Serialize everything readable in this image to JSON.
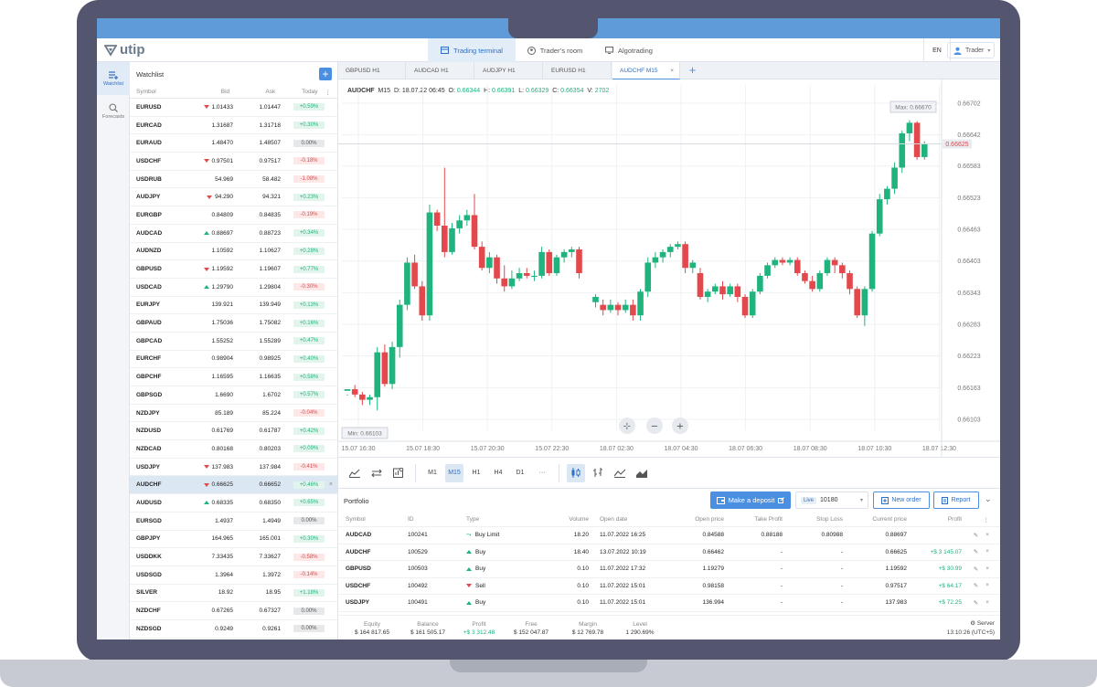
{
  "brand": {
    "name": "utip"
  },
  "nav": {
    "tabs": [
      {
        "label": "Trading terminal",
        "active": true
      },
      {
        "label": "Trader’s room",
        "active": false
      },
      {
        "label": "Algotrading",
        "active": false
      }
    ],
    "lang": "EN",
    "user": "Trader"
  },
  "sidebar": {
    "items": [
      {
        "label": "Watchlist",
        "icon": "watchlist-icon",
        "active": true
      },
      {
        "label": "Forecasts",
        "icon": "forecasts-icon",
        "active": false
      }
    ]
  },
  "watchlist": {
    "title": "Watchlist",
    "columns": [
      "Symbol",
      "Bid",
      "Ask",
      "Today"
    ],
    "rows": [
      {
        "symbol": "EURUSD",
        "bid": "1.01433",
        "ask": "1.01447",
        "today": "+0.59%",
        "dir": "down",
        "trend": "pos"
      },
      {
        "symbol": "EURCAD",
        "bid": "1.31687",
        "ask": "1.31718",
        "today": "+0.30%",
        "dir": "",
        "trend": "pos"
      },
      {
        "symbol": "EURAUD",
        "bid": "1.48470",
        "ask": "1.48507",
        "today": "0.00%",
        "dir": "",
        "trend": "zero"
      },
      {
        "symbol": "USDCHF",
        "bid": "0.97501",
        "ask": "0.97517",
        "today": "-0.18%",
        "dir": "down",
        "trend": "neg"
      },
      {
        "symbol": "USDRUB",
        "bid": "54.969",
        "ask": "58.482",
        "today": "-1.08%",
        "dir": "",
        "trend": "neg"
      },
      {
        "symbol": "AUDJPY",
        "bid": "94.290",
        "ask": "94.321",
        "today": "+0.23%",
        "dir": "down",
        "trend": "pos"
      },
      {
        "symbol": "EURGBP",
        "bid": "0.84809",
        "ask": "0.84835",
        "today": "-0.19%",
        "dir": "",
        "trend": "neg"
      },
      {
        "symbol": "AUDCAD",
        "bid": "0.88697",
        "ask": "0.88723",
        "today": "+0.34%",
        "dir": "up",
        "trend": "pos"
      },
      {
        "symbol": "AUDNZD",
        "bid": "1.10592",
        "ask": "1.10627",
        "today": "+0.28%",
        "dir": "",
        "trend": "pos"
      },
      {
        "symbol": "GBPUSD",
        "bid": "1.19592",
        "ask": "1.19607",
        "today": "+0.77%",
        "dir": "down",
        "trend": "pos"
      },
      {
        "symbol": "USDCAD",
        "bid": "1.29790",
        "ask": "1.29804",
        "today": "-0.30%",
        "dir": "up",
        "trend": "neg"
      },
      {
        "symbol": "EURJPY",
        "bid": "139.921",
        "ask": "139.949",
        "today": "+0.13%",
        "dir": "",
        "trend": "pos"
      },
      {
        "symbol": "GBPAUD",
        "bid": "1.75036",
        "ask": "1.75082",
        "today": "+0.16%",
        "dir": "",
        "trend": "pos"
      },
      {
        "symbol": "GBPCAD",
        "bid": "1.55252",
        "ask": "1.55289",
        "today": "+0.47%",
        "dir": "",
        "trend": "pos"
      },
      {
        "symbol": "EURCHF",
        "bid": "0.98904",
        "ask": "0.98925",
        "today": "+0.40%",
        "dir": "",
        "trend": "pos"
      },
      {
        "symbol": "GBPCHF",
        "bid": "1.16595",
        "ask": "1.16635",
        "today": "+0.58%",
        "dir": "",
        "trend": "pos"
      },
      {
        "symbol": "GBPSGD",
        "bid": "1.6690",
        "ask": "1.6702",
        "today": "+0.57%",
        "dir": "",
        "trend": "pos"
      },
      {
        "symbol": "NZDJPY",
        "bid": "85.189",
        "ask": "85.224",
        "today": "-0.04%",
        "dir": "",
        "trend": "neg"
      },
      {
        "symbol": "NZDUSD",
        "bid": "0.61769",
        "ask": "0.61787",
        "today": "+0.42%",
        "dir": "",
        "trend": "pos"
      },
      {
        "symbol": "NZDCAD",
        "bid": "0.80168",
        "ask": "0.80203",
        "today": "+0.09%",
        "dir": "",
        "trend": "pos"
      },
      {
        "symbol": "USDJPY",
        "bid": "137.983",
        "ask": "137.984",
        "today": "-0.41%",
        "dir": "down",
        "trend": "neg"
      },
      {
        "symbol": "AUDCHF",
        "bid": "0.66625",
        "ask": "0.66652",
        "today": "+0.46%",
        "dir": "down",
        "trend": "pos",
        "selected": true
      },
      {
        "symbol": "AUDUSD",
        "bid": "0.68335",
        "ask": "0.68350",
        "today": "+0.65%",
        "dir": "up",
        "trend": "pos"
      },
      {
        "symbol": "EURSGD",
        "bid": "1.4937",
        "ask": "1.4949",
        "today": "0.00%",
        "dir": "",
        "trend": "zero"
      },
      {
        "symbol": "GBPJPY",
        "bid": "164.965",
        "ask": "165.001",
        "today": "+0.30%",
        "dir": "",
        "trend": "pos"
      },
      {
        "symbol": "USDDKK",
        "bid": "7.33435",
        "ask": "7.33627",
        "today": "-0.58%",
        "dir": "",
        "trend": "neg"
      },
      {
        "symbol": "USDSGD",
        "bid": "1.3964",
        "ask": "1.3972",
        "today": "-0.14%",
        "dir": "",
        "trend": "neg"
      },
      {
        "symbol": "SILVER",
        "bid": "18.92",
        "ask": "18.95",
        "today": "+1.18%",
        "dir": "",
        "trend": "pos"
      },
      {
        "symbol": "NZDCHF",
        "bid": "0.67265",
        "ask": "0.67327",
        "today": "0.00%",
        "dir": "",
        "trend": "zero"
      },
      {
        "symbol": "NZDSGD",
        "bid": "0.9249",
        "ask": "0.9261",
        "today": "0.00%",
        "dir": "",
        "trend": "zero"
      }
    ]
  },
  "chart_tabs": [
    {
      "label": "GBPUSD H1",
      "active": false
    },
    {
      "label": "AUDCAD H1",
      "active": false
    },
    {
      "label": "AUDJPY H1",
      "active": false
    },
    {
      "label": "EURUSD H1",
      "active": false
    },
    {
      "label": "AUDCHF M15",
      "active": true
    }
  ],
  "ohlc": {
    "symbol": "AUDCHF",
    "tf": "M15",
    "d": "D: 18.07.22 06:45",
    "o_label": "O:",
    "o": "0.66344",
    "h_label": "H:",
    "h": "0.66391",
    "l_label": "L:",
    "l": "0.66329",
    "c_label": "C:",
    "c": "0.66354",
    "v_label": "V:",
    "v": "2702"
  },
  "chart_data": {
    "type": "candlestick",
    "y_ticks": [
      "0.66702",
      "0.66642",
      "0.66583",
      "0.66523",
      "0.66463",
      "0.66403",
      "0.66343",
      "0.66283",
      "0.66223",
      "0.66163",
      "0.66103"
    ],
    "ylim": [
      0.66103,
      0.66702
    ],
    "x_ticks": [
      "15.07 16:30",
      "15.07 18:30",
      "15.07 20:30",
      "15.07 22:30",
      "18.07 02:30",
      "18.07 04:30",
      "18.07 06:30",
      "18.07 08:30",
      "18.07 10:30",
      "18.07 12:30"
    ],
    "current_price": "0.66625",
    "max_label": "Max: 0.66670",
    "min_label": "Min: 0.66103",
    "candles": [
      [
        0.66157,
        0.6616,
        0.6615,
        0.66148
      ],
      [
        0.6616,
        0.6615,
        0.66145,
        0.66168
      ],
      [
        0.6615,
        0.6614,
        0.6613,
        0.66155
      ],
      [
        0.6614,
        0.66145,
        0.6613,
        0.6615
      ],
      [
        0.66145,
        0.6623,
        0.6612,
        0.6624
      ],
      [
        0.6623,
        0.6617,
        0.66165,
        0.66245
      ],
      [
        0.6617,
        0.6624,
        0.6616,
        0.6625
      ],
      [
        0.6624,
        0.6632,
        0.6622,
        0.6633
      ],
      [
        0.6632,
        0.664,
        0.6631,
        0.6641
      ],
      [
        0.664,
        0.66355,
        0.6635,
        0.66415
      ],
      [
        0.66355,
        0.663,
        0.6629,
        0.66365
      ],
      [
        0.663,
        0.66495,
        0.6629,
        0.6651
      ],
      [
        0.66495,
        0.6647,
        0.6646,
        0.665
      ],
      [
        0.6647,
        0.6642,
        0.6641,
        0.6658
      ],
      [
        0.6642,
        0.66465,
        0.66415,
        0.66475
      ],
      [
        0.66465,
        0.6648,
        0.66455,
        0.6649
      ],
      [
        0.6648,
        0.6649,
        0.6647,
        0.665
      ],
      [
        0.6649,
        0.6643,
        0.66425,
        0.6653
      ],
      [
        0.6643,
        0.6639,
        0.66385,
        0.6644
      ],
      [
        0.6639,
        0.6641,
        0.6638,
        0.6642
      ],
      [
        0.6641,
        0.6637,
        0.6636,
        0.66415
      ],
      [
        0.6637,
        0.66355,
        0.66345,
        0.66395
      ],
      [
        0.66355,
        0.6637,
        0.6635,
        0.66385
      ],
      [
        0.6637,
        0.6638,
        0.66365,
        0.6639
      ],
      [
        0.6638,
        0.66375,
        0.6637,
        0.6639
      ],
      [
        0.66375,
        0.66375,
        0.66365,
        0.66385
      ],
      [
        0.66375,
        0.6642,
        0.6637,
        0.6643
      ],
      [
        0.6642,
        0.6638,
        0.66375,
        0.66425
      ],
      [
        0.6638,
        0.6641,
        0.66375,
        0.66415
      ],
      [
        0.6641,
        0.6642,
        0.664,
        0.66425
      ],
      [
        0.6642,
        0.66425,
        0.6641,
        0.6643
      ],
      [
        0.66425,
        0.6638,
        0.6637,
        0.6643
      ],
      [
        0.66325,
        0.66335,
        0.66315,
        0.6634
      ],
      [
        0.6632,
        0.6631,
        0.663,
        0.6633
      ],
      [
        0.6631,
        0.6632,
        0.66305,
        0.6633
      ],
      [
        0.6632,
        0.6631,
        0.663,
        0.66325
      ],
      [
        0.6631,
        0.6632,
        0.66305,
        0.6633
      ],
      [
        0.6632,
        0.663,
        0.6629,
        0.6633
      ],
      [
        0.663,
        0.66345,
        0.6629,
        0.6635
      ],
      [
        0.66345,
        0.664,
        0.66335,
        0.6641
      ],
      [
        0.664,
        0.6641,
        0.6639,
        0.6642
      ],
      [
        0.6641,
        0.6642,
        0.664,
        0.66425
      ],
      [
        0.6642,
        0.6643,
        0.6641,
        0.66435
      ],
      [
        0.6643,
        0.66435,
        0.66425,
        0.6644
      ],
      [
        0.66435,
        0.6639,
        0.6638,
        0.6644
      ],
      [
        0.6639,
        0.664,
        0.6638,
        0.66405
      ],
      [
        0.6638,
        0.66335,
        0.6633,
        0.6639
      ],
      [
        0.66335,
        0.66345,
        0.66325,
        0.6635
      ],
      [
        0.66345,
        0.66355,
        0.6634,
        0.6636
      ],
      [
        0.66355,
        0.6634,
        0.6633,
        0.66365
      ],
      [
        0.6634,
        0.66355,
        0.66335,
        0.6636
      ],
      [
        0.66355,
        0.66335,
        0.66325,
        0.6636
      ],
      [
        0.66335,
        0.663,
        0.66295,
        0.6634
      ],
      [
        0.663,
        0.66345,
        0.66295,
        0.6635
      ],
      [
        0.66345,
        0.66375,
        0.6634,
        0.6638
      ],
      [
        0.66375,
        0.66395,
        0.6637,
        0.664
      ],
      [
        0.66395,
        0.66405,
        0.6639,
        0.6641
      ],
      [
        0.66405,
        0.664,
        0.66395,
        0.6641
      ],
      [
        0.664,
        0.66405,
        0.66395,
        0.6641
      ],
      [
        0.66405,
        0.6638,
        0.66375,
        0.6641
      ],
      [
        0.6638,
        0.66365,
        0.6636,
        0.66385
      ],
      [
        0.66365,
        0.6635,
        0.66345,
        0.66375
      ],
      [
        0.6635,
        0.6638,
        0.66345,
        0.66385
      ],
      [
        0.6638,
        0.66405,
        0.66375,
        0.6641
      ],
      [
        0.66405,
        0.66395,
        0.6638,
        0.6641
      ],
      [
        0.66395,
        0.6638,
        0.6637,
        0.664
      ],
      [
        0.6638,
        0.6635,
        0.6634,
        0.66385
      ],
      [
        0.6635,
        0.663,
        0.66295,
        0.66355
      ],
      [
        0.663,
        0.6635,
        0.6628,
        0.66355
      ],
      [
        0.6635,
        0.66455,
        0.66345,
        0.6646
      ],
      [
        0.66455,
        0.6652,
        0.6645,
        0.6653
      ],
      [
        0.6652,
        0.6654,
        0.6651,
        0.66545
      ],
      [
        0.6654,
        0.6658,
        0.6653,
        0.6659
      ],
      [
        0.6658,
        0.66645,
        0.6657,
        0.6665
      ],
      [
        0.66645,
        0.66665,
        0.6663,
        0.6667
      ],
      [
        0.66665,
        0.666,
        0.66595,
        0.66668
      ],
      [
        0.666,
        0.66625,
        0.66595,
        0.6663
      ]
    ]
  },
  "toolbar": {
    "timeframes": [
      {
        "label": "M1",
        "active": false
      },
      {
        "label": "M15",
        "active": true
      },
      {
        "label": "H1",
        "active": false
      },
      {
        "label": "H4",
        "active": false
      },
      {
        "label": "D1",
        "active": false
      },
      {
        "label": "···",
        "active": false
      }
    ]
  },
  "portfolio": {
    "title": "Portfolio",
    "deposit_label": "Make a deposit",
    "account_badge": "Live",
    "account_id": "10180",
    "new_order_label": "New order",
    "report_label": "Report",
    "columns": [
      "Symbol",
      "ID",
      "Type",
      "Volume",
      "Open date",
      "Open price",
      "Take Profit",
      "Stop Loss",
      "Current price",
      "Profit"
    ],
    "rows": [
      {
        "symbol": "AUDCAD",
        "id": "100241",
        "type": "Buy Limit",
        "kind": "limit",
        "volume": "18.20",
        "open_date": "11.07.2022 16:25",
        "open_price": "0.84588",
        "tp": "0.88188",
        "sl": "0.80988",
        "current": "0.88697",
        "profit": ""
      },
      {
        "symbol": "AUDCHF",
        "id": "100529",
        "type": "Buy",
        "kind": "buy",
        "volume": "18.40",
        "open_date": "13.07.2022 10:19",
        "open_price": "0.66462",
        "tp": "-",
        "sl": "-",
        "current": "0.66625",
        "profit": "+$ 3 145.07"
      },
      {
        "symbol": "GBPUSD",
        "id": "100503",
        "type": "Buy",
        "kind": "buy",
        "volume": "0.10",
        "open_date": "11.07.2022 17:32",
        "open_price": "1.19279",
        "tp": "-",
        "sl": "-",
        "current": "1.19592",
        "profit": "+$ 30.99"
      },
      {
        "symbol": "USDCHF",
        "id": "100492",
        "type": "Sell",
        "kind": "sell",
        "volume": "0.10",
        "open_date": "11.07.2022 15:01",
        "open_price": "0.98158",
        "tp": "-",
        "sl": "-",
        "current": "0.97517",
        "profit": "+$ 64.17"
      },
      {
        "symbol": "USDJPY",
        "id": "100491",
        "type": "Buy",
        "kind": "buy",
        "volume": "0.10",
        "open_date": "11.07.2022 15:01",
        "open_price": "136.994",
        "tp": "-",
        "sl": "-",
        "current": "137.983",
        "profit": "+$ 72.25"
      }
    ],
    "footer": [
      {
        "label": "Equity",
        "value": "$ 164 817.65",
        "positive": false
      },
      {
        "label": "Balance",
        "value": "$ 161 505.17",
        "positive": false
      },
      {
        "label": "Profit",
        "value": "+$ 3 312.48",
        "positive": true
      },
      {
        "label": "Free",
        "value": "$ 152 047.87",
        "positive": false
      },
      {
        "label": "Margin",
        "value": "$ 12 769.78",
        "positive": false
      },
      {
        "label": "Level",
        "value": "1 290.69%",
        "positive": false
      }
    ],
    "server_label": "Server",
    "server_time": "13:10:26 (UTC+5)"
  },
  "colors": {
    "accent": "#4a8fe2",
    "bull": "#1fb37d",
    "bear": "#e2484c",
    "frame": "#545670"
  }
}
